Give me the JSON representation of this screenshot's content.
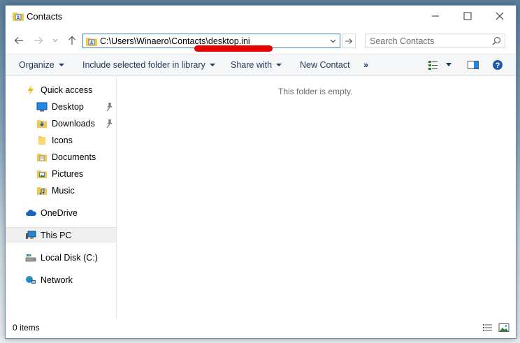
{
  "window": {
    "title": "Contacts",
    "minimize_label": "Minimize",
    "maximize_label": "Maximize",
    "close_label": "Close"
  },
  "address_bar": {
    "path": "C:\\Users\\Winaero\\Contacts\\desktop.ini"
  },
  "search": {
    "placeholder": "Search Contacts",
    "value": ""
  },
  "toolbar": {
    "organize": "Organize",
    "include_library": "Include selected folder in library",
    "share_with": "Share with",
    "new_contact": "New Contact",
    "more": "»"
  },
  "nav_pane": {
    "quick_access": "Quick access",
    "quick_items": [
      {
        "label": "Desktop",
        "pinned": true
      },
      {
        "label": "Downloads",
        "pinned": true
      },
      {
        "label": "Icons",
        "pinned": false
      },
      {
        "label": "Documents",
        "pinned": false
      },
      {
        "label": "Pictures",
        "pinned": false
      },
      {
        "label": "Music",
        "pinned": false
      }
    ],
    "onedrive": "OneDrive",
    "this_pc": "This PC",
    "local_disk": "Local Disk (C:)",
    "network": "Network"
  },
  "content": {
    "empty_message": "This folder is empty."
  },
  "status_bar": {
    "items_count": "0 items"
  },
  "colors": {
    "accent": "#3c7fb1",
    "command_text": "#1e395b",
    "highlight_mark": "#e60000",
    "folder_yellow": "#f6c94a"
  }
}
